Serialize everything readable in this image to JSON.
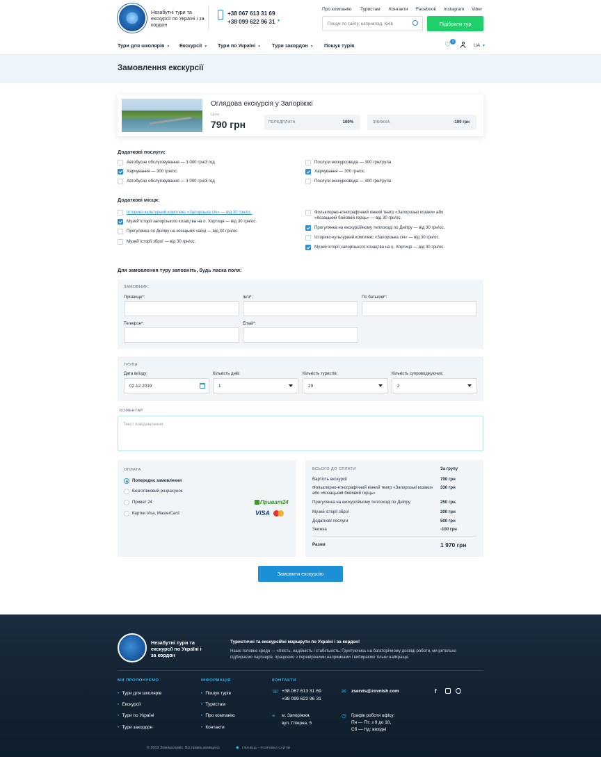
{
  "header": {
    "tagline": "Незабутні тури та екскурсії по Україні і за кордон",
    "phone1": "+38 067 613 31 69",
    "phone2": "+38 099 622 96 31",
    "top_links": [
      "Про компанію",
      "Туристам",
      "Контакти",
      "Facebook",
      "Instagram",
      "Viber"
    ],
    "search_placeholder": "Пошук по сайту, наприклад, Київ",
    "pick_tour_label": "Підібрати тур",
    "nav": [
      "Тури для школярів",
      "Екскурсії",
      "Тури по Україні",
      "Тури закордон",
      "Пошук турів"
    ],
    "wishlist_count": "1",
    "lang": "UA"
  },
  "page_title": "Замовлення екскурсії",
  "tour": {
    "name": "Оглядова екскурсія у Запоріжжі",
    "price_label": "Ціна",
    "price": "790 грн",
    "prepay_label": "ПЕРЕДПЛАТА",
    "prepay_value": "100%",
    "discount_label": "ЗНИЖКА",
    "discount_value": "-100 грн"
  },
  "extra_services": {
    "title": "Додаткові послуги:",
    "left": [
      {
        "label": "Автобусне обслуговування — 3 000 грн/3 год",
        "checked": false
      },
      {
        "label": "Харчування — 300 грн/ос.",
        "checked": true
      },
      {
        "label": "Автобусне обслуговування — 3 000 грн/3 год",
        "checked": false
      }
    ],
    "right": [
      {
        "label": "Послуги екскурсовода — 300 грн/група",
        "checked": false
      },
      {
        "label": "Харчування — 300 грн/ос.",
        "checked": true
      },
      {
        "label": "Послуги екскурсовода — 300 грн/група",
        "checked": false
      }
    ]
  },
  "extra_places": {
    "title": "Додаткові місця:",
    "left": [
      {
        "label": "Історико-культурний комплекс «Запорізька січ» — від 30 грн/ос.",
        "checked": false
      },
      {
        "label": "Музей історії запорізького козацтва на о. Хортиця — від 30 грн/ос.",
        "checked": true
      },
      {
        "label": "Прогулянка по Дніпру на козацькій чайці — від 30 грн/ос.",
        "checked": false
      },
      {
        "label": "Музей історії зброї — від 30 грн/ос.",
        "checked": false
      }
    ],
    "right": [
      {
        "label1": "Фольклорно-етнографічний кінний театр «Запорозькі козаки» або",
        "label2": "«Козацький бойовий герць» — від 30 грн/ос.",
        "checked": false
      },
      {
        "label1": "Прогулянка на екскурсійному теплоході по Дніпру — від 30 грн/ос.",
        "checked": true
      },
      {
        "label1": "Історико-культурний комплекс «Запорізька січ» — від 30 грн/ос.",
        "checked": false
      },
      {
        "label1": "Музей історії запорізького козацтва на о. Хортиця — від 30 грн/ос.",
        "checked": true
      }
    ]
  },
  "form": {
    "intro": "Для замовлення туру заповніть, будь ласка поля:",
    "customer_title": "ЗАМОВНИК",
    "surname_label": "Прізвище*:",
    "name_label": "Ім'я*:",
    "patronymic_label": "По батькові*:",
    "phone_label": "Телефон*:",
    "email_label": "Email*:",
    "group_title": "ГРУПА",
    "date_label": "Дата виїзду:",
    "date_value": "02.12.2019",
    "days_label": "Кількість днів:",
    "days_value": "1",
    "tourists_label": "Кількість туристів:",
    "tourists_value": "20",
    "escorts_label": "Кількість супроводжуючих:",
    "escorts_value": "2",
    "comment_title": "КОМЕНТАР",
    "comment_placeholder": "Текст повідомлення"
  },
  "payment": {
    "title": "ОПЛАТА",
    "options": [
      {
        "label": "Попереднє замовлення",
        "selected": true
      },
      {
        "label": "Безготівковий розрахунок",
        "selected": false
      },
      {
        "label": "Приват 24",
        "selected": false
      },
      {
        "label": "Картки Visa, MasterCard",
        "selected": false
      }
    ],
    "privat_logo": "Приват24",
    "visa_logo": "VISA"
  },
  "summary": {
    "title": "ВСЬОГО ДО СПЛАТИ",
    "per_group": "За групу",
    "rows": [
      {
        "label": "Вартість екскурсії",
        "value": "790 грн"
      },
      {
        "label": "Фольклорно-етнографічний кінний театр «Запорозькі козаки» або «Козацький бойовий герць»",
        "value": "330 грн"
      },
      {
        "label": "Прогулянка на екскурсійному теплоході по Дніпру",
        "value": "250 грн"
      },
      {
        "label": "Музей історії зброї",
        "value": "200 грн"
      },
      {
        "label": "Додаткові послуги",
        "value": "500 грн"
      },
      {
        "label": "Знижка",
        "value": "-100 грн"
      }
    ],
    "total_label": "Разом",
    "total_value": "1 970 грн"
  },
  "order_button": "Замовити екскурсію",
  "footer": {
    "tagline": "Незабутні тури та екскурсії по Україні і за кордон",
    "heading": "Туристичні та екскурсійні маршрути по Україні і за кордон!",
    "text1": "Наше головне кредо — чіткість, надійність і стабільність. Ґрунтуючись на багаторічному досвіді роботи, ми ретельно",
    "text2": "підбираємо партнерів, працюємо з перевіреними напрямками і вибираємо тільки найкраще.",
    "offer_title": "МИ ПРОПОНУЄМО",
    "offer_links": [
      "Тури для школярів",
      "Екскурсії",
      "Тури по Україні",
      "Тури закордон"
    ],
    "info_title": "ІНФОРМАЦІЯ",
    "info_links": [
      "Пошук турів",
      "Туристам",
      "Про компанію",
      "Контакти"
    ],
    "contacts_title": "КОНТАКТИ",
    "phone1": "+38 067 613 31 69",
    "phone2": "+38 099 622 96 31",
    "email": "zservis@zovnish.com",
    "address1": "м. Запоріжжя,",
    "address2": "вул. Гліерна, 5",
    "hours_title": "Графік роботи офісу:",
    "hours1": "Пн — Пт: з 9 до 18,",
    "hours2": "Сб — Нд: вихідні",
    "copyright": "© 2019 Зовнішсервіс. Всі права захищено",
    "dev": "ГЛИНЕЦЬ – РОЗРОБКА САЙТІВ"
  },
  "colors": {
    "accent": "#2c8fd6",
    "green": "#1fcf6a",
    "footer_bg": "#142434"
  }
}
